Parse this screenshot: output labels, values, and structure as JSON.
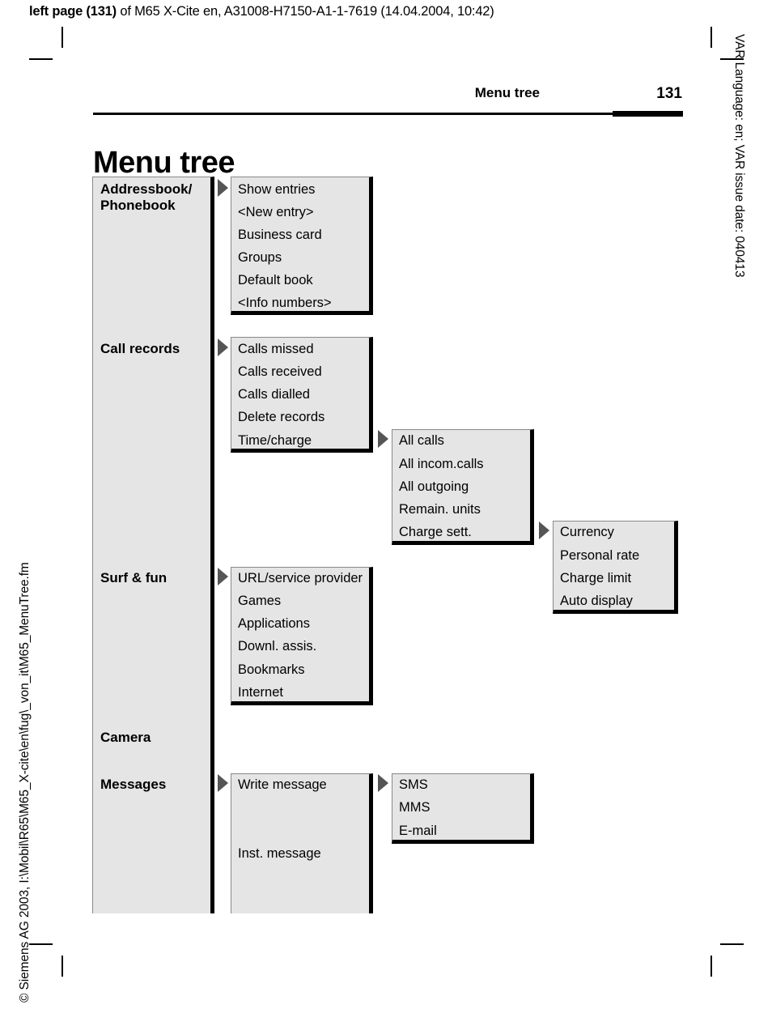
{
  "print_header": {
    "bold_part": "left page (131)",
    "rest": " of M65 X-Cite en, A31008-H7150-A1-1-7619 (14.04.2004, 10:42)"
  },
  "side_text": {
    "right": "VAR Language: en; VAR issue date: 040413",
    "left": "© Siemens AG 2003, I:\\Mobil\\R65\\M65_X-cite\\en\\fug\\_von_it\\M65_MenuTree.fm"
  },
  "running_head": {
    "title": "Menu tree",
    "page_number": "131"
  },
  "chapter_title": "Menu tree",
  "colors": {
    "box_fill": "#e5e5e5",
    "box_shadow": "#000000",
    "box_hairline": "#888888",
    "arrow": "#555555",
    "text": "#000000"
  },
  "menu_tree": {
    "level1": [
      {
        "label": "Addressbook/",
        "label2": "Phonebook",
        "has_arrow": true
      },
      {
        "label": "Call records",
        "has_arrow": true
      },
      {
        "label": "Surf & fun",
        "has_arrow": true
      },
      {
        "label": "Camera",
        "has_arrow": false
      },
      {
        "label": "Messages",
        "has_arrow": true
      }
    ],
    "addressbook_items": [
      "Show entries",
      "<New entry>",
      "Business card",
      "Groups",
      "Default book",
      "<Info numbers>"
    ],
    "call_records_items": [
      "Calls missed",
      "Calls received",
      "Calls dialled",
      "Delete records",
      "Time/charge"
    ],
    "time_charge_items": [
      "All calls",
      "All incom.calls",
      "All outgoing",
      "Remain. units",
      "Charge sett."
    ],
    "charge_sett_items": [
      "Currency",
      "Personal rate",
      "Charge limit",
      "Auto display"
    ],
    "surf_fun_items": [
      "URL/service provider",
      "Games",
      "Applications",
      "Downl. assis.",
      "Bookmarks",
      "Internet"
    ],
    "messages_items": [
      "Write message",
      "Inst. message"
    ],
    "write_message_items": [
      "SMS",
      "MMS",
      "E-mail"
    ]
  }
}
